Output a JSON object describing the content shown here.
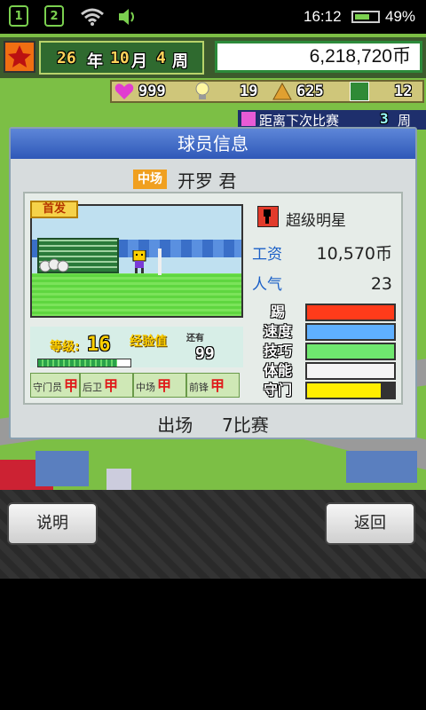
{
  "status_bar": {
    "sim1": "1",
    "sim2": "2",
    "time": "16:12",
    "battery": "49%"
  },
  "hud": {
    "year": "26",
    "year_unit": "年",
    "month": "10",
    "month_unit": "月",
    "week": "4",
    "week_unit": "周",
    "money": "6,218,720币",
    "hearts": "999",
    "bulbs": "19",
    "points": "625",
    "fields": "12",
    "ticker_text": "距离下次比赛",
    "ticker_num": "3",
    "ticker_unit": "周"
  },
  "dialog": {
    "title": "球员信息",
    "position_badge": "中场",
    "player_name": "开罗 君",
    "starter_badge": "首发",
    "rank_title": "超级明星",
    "salary_label": "工资",
    "salary_value": "10,570币",
    "popularity_label": "人气",
    "popularity_value": "23",
    "level_label": "等级:",
    "level_value": "16",
    "exp_label": "经验值",
    "exp_sub": "还有",
    "exp_value": "99",
    "positions": [
      {
        "label": "守门员",
        "mark": "甲"
      },
      {
        "label": "后卫",
        "mark": "甲"
      },
      {
        "label": "中场",
        "mark": "甲"
      },
      {
        "label": "前锋",
        "mark": "甲"
      }
    ],
    "skills": [
      {
        "label": "踢",
        "color": "#ff3b1a",
        "fill": 1.0
      },
      {
        "label": "速度",
        "color": "#5fb0ff",
        "fill": 1.0
      },
      {
        "label": "技巧",
        "color": "#6fe86f",
        "fill": 1.0
      },
      {
        "label": "体能",
        "color": "#f4f4f4",
        "fill": 1.0
      },
      {
        "label": "守门",
        "color": "#ffee00",
        "fill": 0.85
      }
    ],
    "appearances_label": "出场",
    "appearances_value": "7比赛"
  },
  "buttons": {
    "help": "说明",
    "back": "返回"
  }
}
